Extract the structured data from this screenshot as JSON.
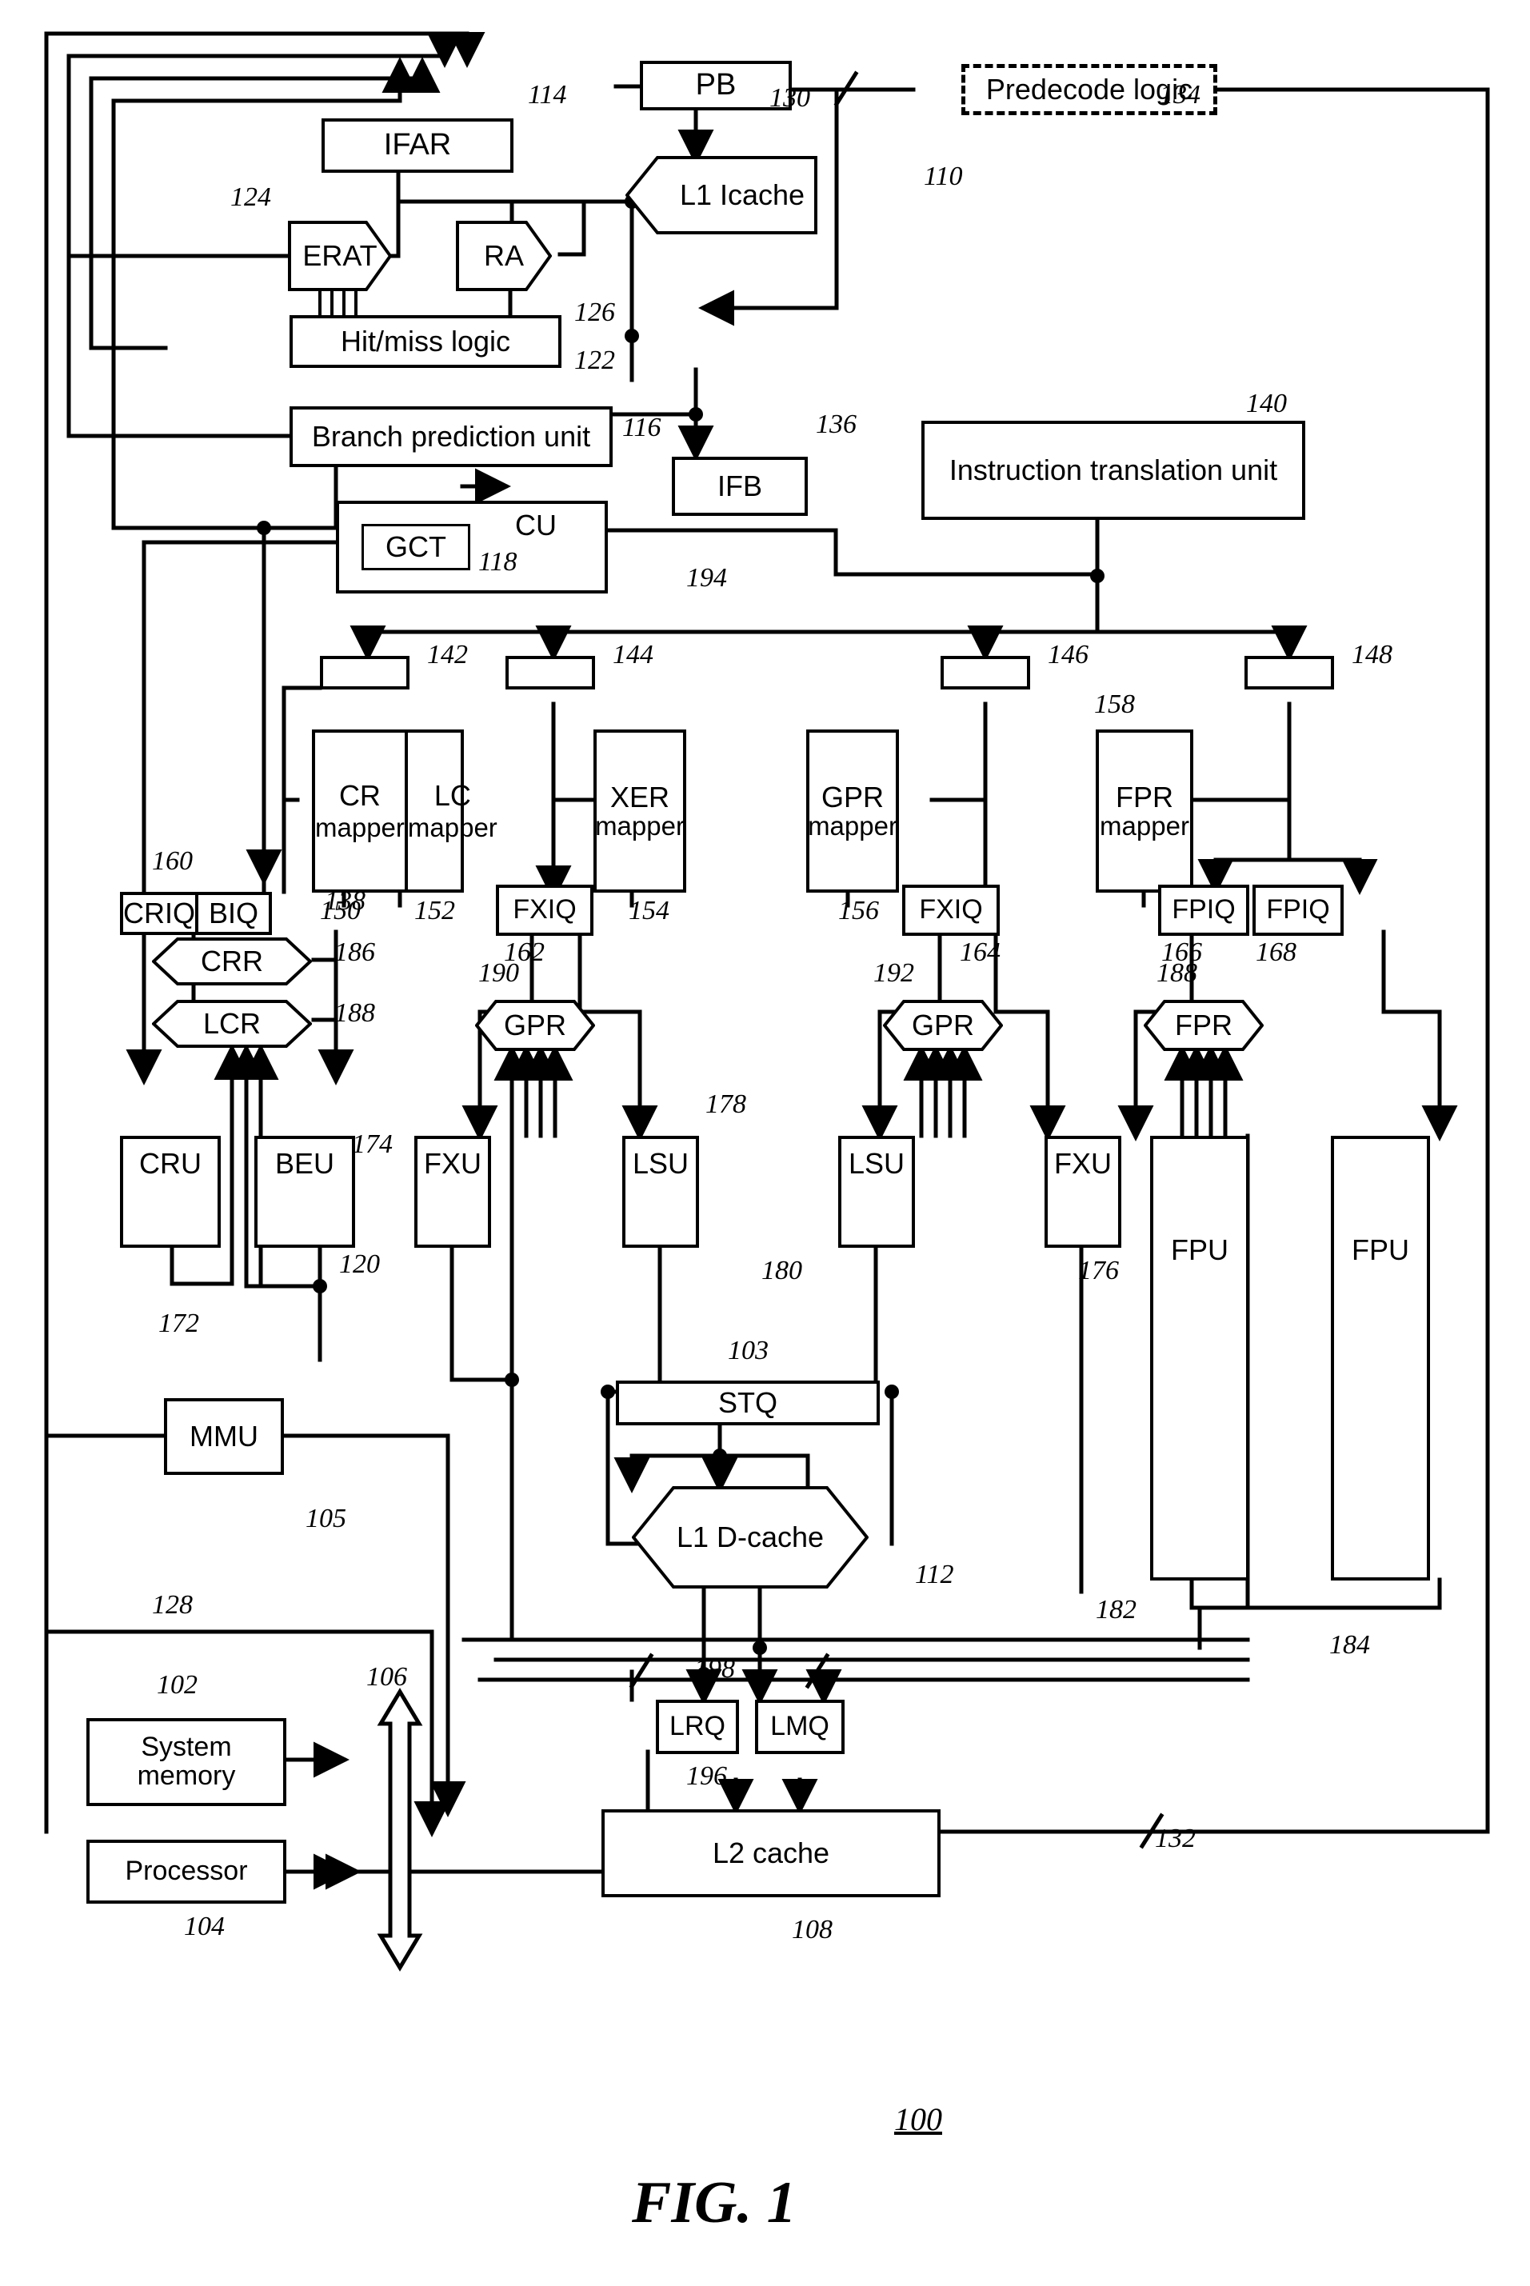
{
  "figure": {
    "number": "100",
    "caption": "FIG. 1"
  },
  "blocks": {
    "ifar": "IFAR",
    "pb": "PB",
    "predecode_logic": "Predecode logic",
    "erat": "ERAT",
    "ra": "RA",
    "l1_icache": "L1 Icache",
    "hit_miss_logic": "Hit/miss logic",
    "branch_prediction_unit": "Branch prediction unit",
    "ifb": "IFB",
    "instruction_translation_unit": "Instruction translation unit",
    "gct": "GCT",
    "cu": "CU",
    "cr_mapper_top": "CR",
    "cr_mapper_bot": "mapper",
    "lc_mapper_top": "LC",
    "lc_mapper_bot": "mapper",
    "xer_mapper_top": "XER",
    "xer_mapper_bot": "mapper",
    "gpr_mapper_top": "GPR",
    "gpr_mapper_bot": "mapper",
    "fpr_mapper_top": "FPR",
    "fpr_mapper_bot": "mapper",
    "criq": "CRIQ",
    "biq": "BIQ",
    "fxiq_left": "FXIQ",
    "fxiq_right": "FXIQ",
    "fpiq_left": "FPIQ",
    "fpiq_right": "FPIQ",
    "crr": "CRR",
    "lcr": "LCR",
    "gpr_left": "GPR",
    "gpr_right": "GPR",
    "fpr": "FPR",
    "cru": "CRU",
    "beu": "BEU",
    "fxu_left": "FXU",
    "lsu_left": "LSU",
    "lsu_right": "LSU",
    "fxu_right": "FXU",
    "fpu_left": "FPU",
    "fpu_right": "FPU",
    "mmu": "MMU",
    "stq": "STQ",
    "l1_dcache": "L1 D-cache",
    "lrq": "LRQ",
    "lmq": "LMQ",
    "system_memory": "System memory",
    "processor": "Processor",
    "l2_cache": "L2 cache"
  },
  "refs": {
    "r100": "100",
    "r102": "102",
    "r103": "103",
    "r104": "104",
    "r105": "105",
    "r106": "106",
    "r108": "108",
    "r110": "110",
    "r112": "112",
    "r114": "114",
    "r116": "116",
    "r118": "118",
    "r120": "120",
    "r122": "122",
    "r124": "124",
    "r126": "126",
    "r128": "128",
    "r130": "130",
    "r132": "132",
    "r134": "134",
    "r136": "136",
    "r138": "138",
    "r140": "140",
    "r142": "142",
    "r144": "144",
    "r146": "146",
    "r148": "148",
    "r150": "150",
    "r152": "152",
    "r154": "154",
    "r156": "156",
    "r158": "158",
    "r160": "160",
    "r162": "162",
    "r164": "164",
    "r166": "166",
    "r168": "168",
    "r172": "172",
    "r174": "174",
    "r176": "176",
    "r178": "178",
    "r180": "180",
    "r182": "182",
    "r184": "184",
    "r186": "186",
    "r188": "188",
    "r190": "190",
    "r192": "192",
    "r194": "194",
    "r196": "196",
    "r198": "198"
  }
}
